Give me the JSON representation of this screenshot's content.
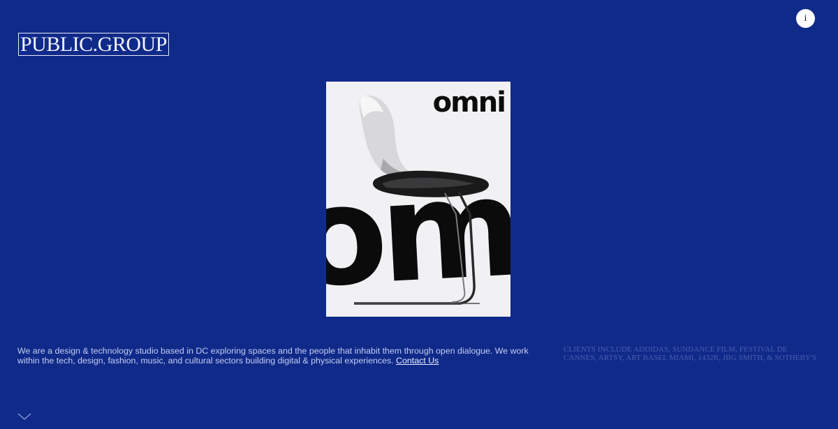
{
  "header": {
    "logo_text": "PUBLIC.GROUP",
    "info_label": "i"
  },
  "feature": {
    "cover_title": "omni",
    "cover_big_text": "omni"
  },
  "footer": {
    "about_text": "We are a design & technology studio based in DC exploring spaces and the people that inhabit them through open dialogue. We work within the tech, design, fashion, music, and cultural sectors building digital & physical experiences.",
    "contact_label": "Contact Us",
    "clients_text": "CLIENTS INCLUDE ADDIDAS, SUNDANCE FILM, FESTIVAL DE CANNES, ARTSY, ART BASEL MIAMI, 1432R, JBG SMITH, & SOTHEBY'S"
  },
  "icons": {
    "scroll": "chevron-down-icon"
  },
  "colors": {
    "background": "#102a8a",
    "cover_background": "#f1f1f4",
    "text": "#c5cdef",
    "clients_text": "#4b5fae"
  }
}
